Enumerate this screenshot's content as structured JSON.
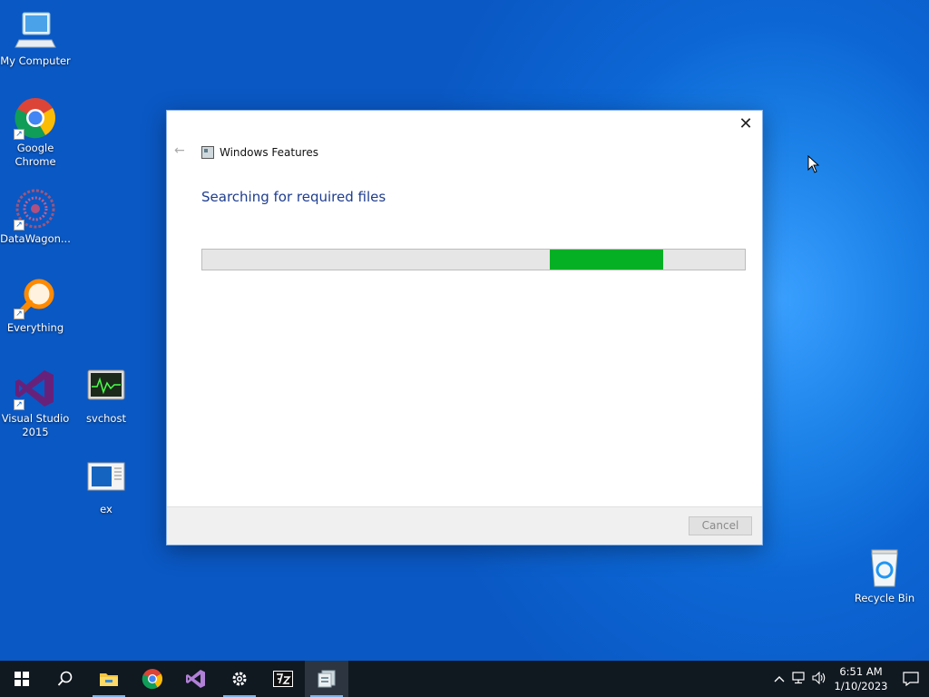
{
  "desktop": {
    "icons": [
      {
        "label": "My Computer"
      },
      {
        "label": "Google Chrome"
      },
      {
        "label": "DataWagon..."
      },
      {
        "label": "Everything"
      },
      {
        "label": "Visual Studio 2015"
      },
      {
        "label": "svchost"
      },
      {
        "label": "ex"
      },
      {
        "label": "Recycle Bin"
      }
    ]
  },
  "dialog": {
    "title": "Windows Features",
    "close_glyph": "✕",
    "back_glyph": "←",
    "heading": "Searching for required files",
    "progress": {
      "fill_start_fraction": 0.64,
      "fill_width_fraction": 0.21
    },
    "cancel_label": "Cancel"
  },
  "taskbar": {
    "clock_time": "6:51 AM",
    "clock_date": "1/10/2023"
  },
  "colors": {
    "desktop_blue": "#0c66d4",
    "progress_green": "#06b025",
    "heading_blue": "#1e3d8f",
    "taskbar": "#101820"
  }
}
